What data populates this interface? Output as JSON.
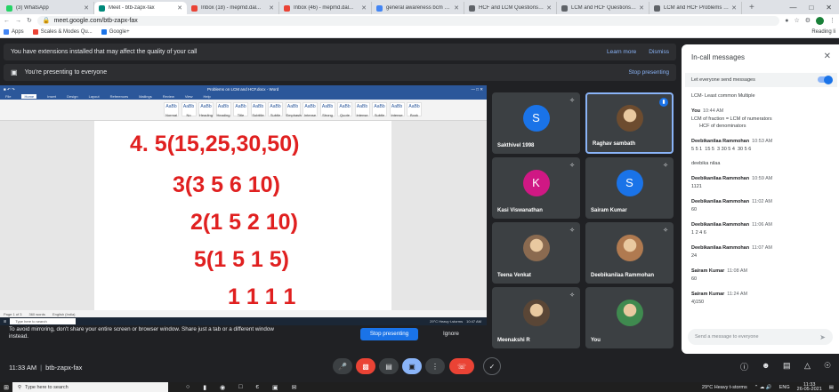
{
  "tabs": [
    {
      "label": "(3) WhatsApp",
      "color": "#25d366",
      "active": false
    },
    {
      "label": "Meet - btb-zapx-fax",
      "color": "#00897b",
      "active": true
    },
    {
      "label": "Inbox (18) - mepmd.dal...",
      "color": "#ea4335",
      "active": false
    },
    {
      "label": "Inbox (46) - mepmd.dal...",
      "color": "#ea4335",
      "active": false
    },
    {
      "label": "general awareness bcm qu...",
      "color": "#4285f4",
      "active": false
    },
    {
      "label": "HCF and LCM Questions -...",
      "color": "#5f6368",
      "active": false
    },
    {
      "label": "LCM and HCF Questions f...",
      "color": "#5f6368",
      "active": false
    },
    {
      "label": "LCM and HCF Problems -...",
      "color": "#5f6368",
      "active": false
    }
  ],
  "browser": {
    "url": "meet.google.com/btb-zapx-fax",
    "bookmarks": [
      "Apps",
      "Scales & Modes Qu...",
      "Google+"
    ],
    "reading_list": "Reading li"
  },
  "banners": {
    "extensions": {
      "text": "You have extensions installed that may affect the quality of your call",
      "learn_more": "Learn more",
      "dismiss": "Dismiss"
    },
    "presenting": {
      "text": "You're presenting to everyone",
      "stop": "Stop presenting"
    }
  },
  "shared_screen": {
    "word_title": "Problems on LCM and HCF.docx - Word",
    "ribbon_tabs": [
      "File",
      "Home",
      "Insert",
      "Design",
      "Layout",
      "References",
      "Mailings",
      "Review",
      "View",
      "Help"
    ],
    "styles": [
      "Normal",
      "No Spac...",
      "Heading 1",
      "Heading 2",
      "Title",
      "Subtitle",
      "Subtle Em...",
      "Emphasis",
      "Intense E...",
      "Strong",
      "Quote",
      "Intense Q...",
      "Subtle Ref...",
      "Intense Re...",
      "Book Title"
    ],
    "math_lines": [
      "4. 5(15,25,30,50)",
      "3(3 5 6 10)",
      "2(1 5 2 10)",
      "5(1 5 1 5)",
      "1 1 1 1"
    ],
    "status": [
      "Page 1 of 3",
      "360 words",
      "English (India)"
    ],
    "task_search": "Type here to search",
    "task_weather": "29°C  Heavy t-storms",
    "task_time": "10:47 AM"
  },
  "participants": [
    {
      "name": "Sakthivel 1998",
      "initial": "S",
      "color": "#1a73e8",
      "selected": false
    },
    {
      "name": "Raghav sambath",
      "initial": "",
      "color": "#6d4c2f",
      "selected": true
    },
    {
      "name": "Kasi Viswanathan",
      "initial": "K",
      "color": "#d01884",
      "selected": false
    },
    {
      "name": "Sairam Kumar",
      "initial": "S",
      "color": "#1a73e8",
      "selected": false
    },
    {
      "name": "Teena Venkat",
      "initial": "",
      "color": "#8a6a50",
      "selected": false
    },
    {
      "name": "Deebikanilaa Rammohan",
      "initial": "",
      "color": "#b07a50",
      "selected": false
    },
    {
      "name": "Meenakshi R",
      "initial": "",
      "color": "#5a4636",
      "selected": false
    },
    {
      "name": "You",
      "initial": "",
      "color": "#3f8a4f",
      "selected": false
    }
  ],
  "chat": {
    "title": "In-call messages",
    "allow_label": "Let everyone send messages",
    "messages": [
      {
        "sender": "",
        "time": "",
        "text": "LCM- Least common Multiple"
      },
      {
        "sender": "You",
        "time": "10:44 AM",
        "text": "LCM of fraction = LCM of numerators\n      HCF of denominators"
      },
      {
        "sender": "Deebikanilaa Rammohan",
        "time": "10:53 AM",
        "text": "5 5 1  15 5  3 30 5 4  30 5 6\n\ndeebika nilaa"
      },
      {
        "sender": "Deebikanilaa Rammohan",
        "time": "10:59 AM",
        "text": "1121"
      },
      {
        "sender": "Deebikanilaa Rammohan",
        "time": "11:02 AM",
        "text": "60"
      },
      {
        "sender": "Deebikanilaa Rammohan",
        "time": "11:06 AM",
        "text": "1 2 4 6"
      },
      {
        "sender": "Deebikanilaa Rammohan",
        "time": "11:07 AM",
        "text": "24"
      },
      {
        "sender": "Sairam Kumar",
        "time": "11:08 AM",
        "text": "60"
      },
      {
        "sender": "Sairam Kumar",
        "time": "11:24 AM",
        "text": "4)150"
      }
    ],
    "input_placeholder": "Send a message to everyone"
  },
  "mirror_warning": {
    "text": "To avoid mirroring, don't share your entire screen or browser window. Share just a tab or a different window instead.",
    "stop": "Stop presenting",
    "ignore": "Ignore"
  },
  "bottom_bar": {
    "time": "11:33 AM",
    "separator": "|",
    "meeting_code": "btb-zapx-fax"
  },
  "taskbar": {
    "search": "Type here to search",
    "weather": "29°C  Heavy t-storms",
    "lang": "ENG",
    "time": "11:33",
    "date": "26-05-2021"
  }
}
